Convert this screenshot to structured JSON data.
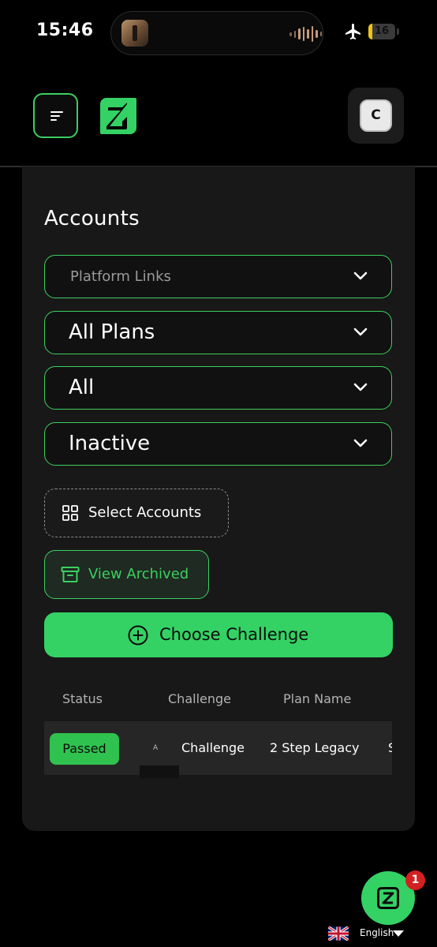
{
  "status_bar": {
    "time": "15:46",
    "battery": "16",
    "battery_level": 0.16
  },
  "header": {
    "avatar_initial": "C"
  },
  "page": {
    "title": "Accounts"
  },
  "filters": [
    {
      "value": "Platform Links",
      "is_placeholder": true
    },
    {
      "value": "All Plans",
      "is_placeholder": false
    },
    {
      "value": "All",
      "is_placeholder": false
    },
    {
      "value": "Inactive",
      "is_placeholder": false
    }
  ],
  "actions": {
    "select_accounts": "Select Accounts",
    "view_archived": "View Archived",
    "choose_challenge": "Choose Challenge"
  },
  "table": {
    "columns": [
      "Status",
      "Challenge",
      "Plan Name"
    ],
    "rows": [
      {
        "status": "Passed",
        "challenge_prefix": "А",
        "challenge": "Challenge",
        "plan_name": "2 Step Legacy",
        "extra": "S"
      }
    ]
  },
  "colors": {
    "accent": "#34d264",
    "card": "#181818",
    "background": "#000000",
    "badge_red": "#d32020"
  },
  "footer": {
    "notification_count": "1",
    "language": "English"
  },
  "icons": [
    "menu-icon",
    "logo-icon",
    "chevron-down-icon",
    "grid-icon",
    "archive-icon",
    "plus-circle-icon",
    "uk-flag-icon",
    "caret-down-icon",
    "airplane-icon"
  ]
}
